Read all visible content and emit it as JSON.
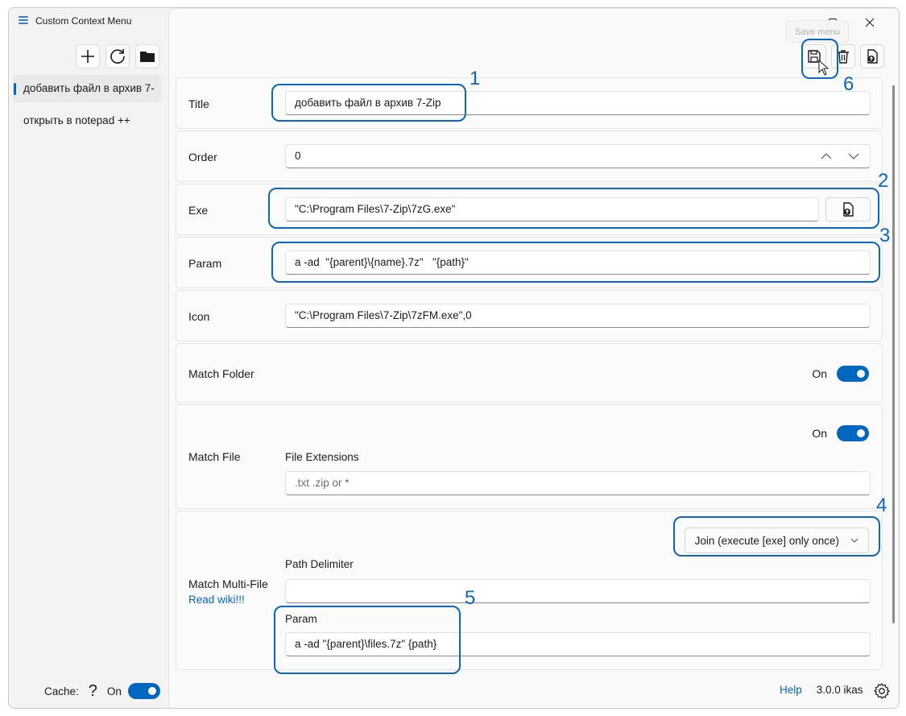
{
  "app": {
    "title": "Custom Context Menu"
  },
  "sidebar": {
    "items": [
      {
        "label": "добавить файл в архив 7-"
      },
      {
        "label": "открыть в notepad ++"
      }
    ],
    "cache_label": "Cache:",
    "cache_help": "?",
    "cache_state": "On"
  },
  "toolbar": {
    "tooltip": "Save menu"
  },
  "form": {
    "title_label": "Title",
    "title_value": "добавить файл в архив 7-Zip",
    "order_label": "Order",
    "order_value": "0",
    "exe_label": "Exe",
    "exe_value": "\"C:\\Program Files\\7-Zip\\7zG.exe\"",
    "param_label": "Param",
    "param_value": "a -ad  \"{parent}\\{name}.7z\"   \"{path}\"",
    "icon_label": "Icon",
    "icon_value": "\"C:\\Program Files\\7-Zip\\7zFM.exe\",0",
    "match_folder_label": "Match Folder",
    "match_folder_state": "On",
    "match_file_label": "Match File",
    "match_file_state": "On",
    "file_ext_label": "File Extensions",
    "file_ext_placeholder": ".txt .zip  or *",
    "multi_label": "Match Multi-File",
    "multi_link": "Read wiki!!!",
    "multi_mode": "Join (execute [exe] only once)",
    "path_delim_label": "Path Delimiter",
    "path_delim_value": "",
    "multi_param_label": "Param",
    "multi_param_value": "a -ad \"{parent}\\files.7z\" {path}"
  },
  "footer": {
    "help": "Help",
    "version": "3.0.0 ikas"
  },
  "callouts": [
    "1",
    "2",
    "3",
    "4",
    "5",
    "6"
  ],
  "colors": {
    "accent": "#0067c0",
    "callout": "#0a66c2"
  }
}
